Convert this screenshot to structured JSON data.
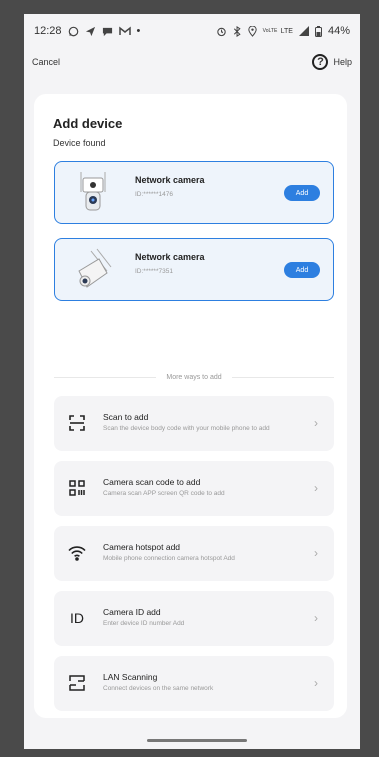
{
  "status_bar": {
    "time": "12:28",
    "left_icons": [
      "whatsapp-icon",
      "send-icon",
      "chat-icon",
      "gmail-icon",
      "dot-icon"
    ],
    "right_icons": [
      "alarm-icon",
      "bluetooth-icon",
      "location-icon",
      "volte-icon",
      "lte-icon",
      "signal-icon",
      "battery-icon"
    ],
    "volte_text": "VoLTE",
    "lte_text": "LTE",
    "battery": "44%"
  },
  "topbar": {
    "cancel": "Cancel",
    "help": "Help",
    "help_glyph": "?"
  },
  "main": {
    "title": "Add device",
    "subtitle": "Device found",
    "devices": [
      {
        "name": "Network camera",
        "id": "ID:******1476",
        "add": "Add",
        "icon": "dome-camera-icon"
      },
      {
        "name": "Network camera",
        "id": "ID:******7351",
        "add": "Add",
        "icon": "bullet-camera-icon"
      }
    ],
    "more_label": "More ways to add",
    "options": [
      {
        "title": "Scan to add",
        "desc": "Scan the device body code with your mobile phone to add",
        "icon": "scan-icon"
      },
      {
        "title": "Camera scan code to add",
        "desc": "Camera scan APP screen QR code to add",
        "icon": "qr-code-icon"
      },
      {
        "title": "Camera hotspot add",
        "desc": "Mobile phone connection camera hotspot Add",
        "icon": "wifi-icon"
      },
      {
        "title": "Camera ID add",
        "desc": "Enter device ID number Add",
        "icon": "id-icon",
        "icon_text": "ID"
      },
      {
        "title": "LAN Scanning",
        "desc": "Connect devices on the same network",
        "icon": "lan-icon"
      }
    ],
    "chevron": "›"
  }
}
